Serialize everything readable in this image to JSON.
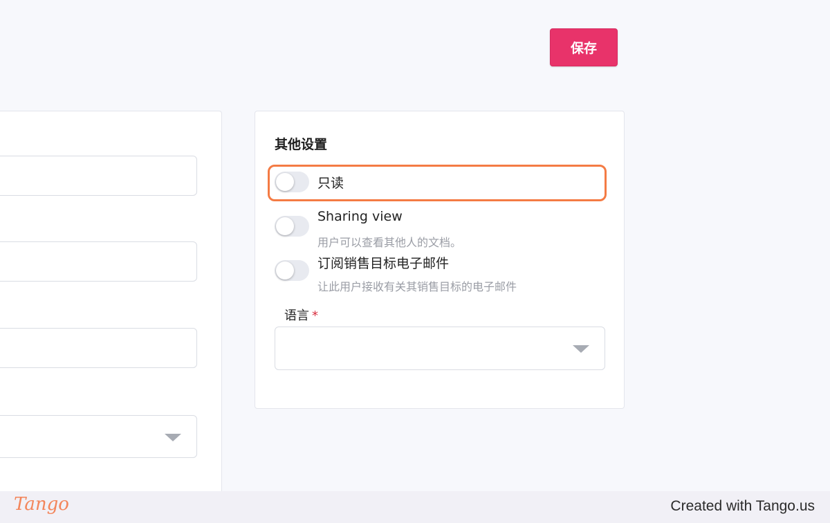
{
  "toolbar": {
    "save_label": "保存"
  },
  "settings": {
    "title": "其他设置",
    "toggles": [
      {
        "label": "只读",
        "description": "",
        "on": false
      },
      {
        "label": "Sharing view",
        "description": "用户可以查看其他人的文档。",
        "on": false
      },
      {
        "label": "订阅销售目标电子邮件",
        "description": "让此用户接收有关其销售目标的电子邮件",
        "on": false
      }
    ],
    "language": {
      "label": "语言",
      "required_mark": "*",
      "value": ""
    }
  },
  "footer": {
    "logo": "Tango",
    "credit": "Created with Tango.us"
  },
  "colors": {
    "accent": "#e8336a",
    "highlight": "#f47b44"
  }
}
